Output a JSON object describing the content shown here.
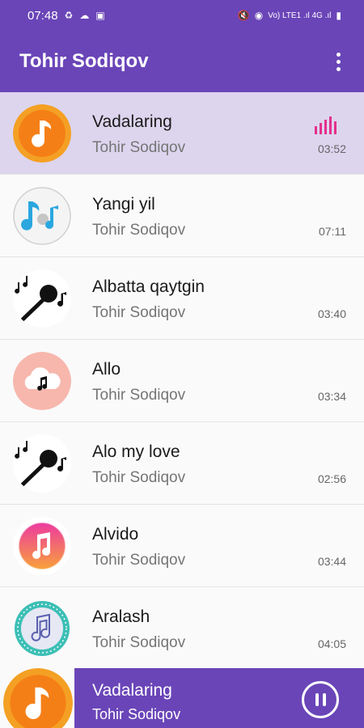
{
  "status_bar": {
    "time": "07:48",
    "right_text": "Vo) LTE1 .ıl  4G .ıl"
  },
  "app_bar": {
    "title": "Tohir Sodiqov"
  },
  "songs": [
    {
      "title": "Vadalaring",
      "artist": "Tohir Sodiqov",
      "duration": "03:52",
      "icon": "orange-music-note-icon"
    },
    {
      "title": "Yangi yil",
      "artist": "Tohir Sodiqov",
      "duration": "07:11",
      "icon": "blue-music-notes-icon"
    },
    {
      "title": "Albatta qaytgin",
      "artist": "Tohir Sodiqov",
      "duration": "03:40",
      "icon": "microphone-notes-icon"
    },
    {
      "title": "Allo",
      "artist": "Tohir Sodiqov",
      "duration": "03:34",
      "icon": "cloud-music-icon"
    },
    {
      "title": "Alo my love",
      "artist": "Tohir Sodiqov",
      "duration": "02:56",
      "icon": "microphone-notes-icon"
    },
    {
      "title": "Alvido",
      "artist": "Tohir Sodiqov",
      "duration": "03:44",
      "icon": "gradient-music-note-icon"
    },
    {
      "title": "Aralash",
      "artist": "Tohir Sodiqov",
      "duration": "04:05",
      "icon": "teal-music-note-icon"
    }
  ],
  "player": {
    "title": "Vadalaring",
    "artist": "Tohir Sodiqov",
    "state": "playing"
  },
  "colors": {
    "primary": "#6a45b8",
    "active_row": "#ddd5ee",
    "equalizer": "#e3308c",
    "orange": "#f7931e"
  }
}
